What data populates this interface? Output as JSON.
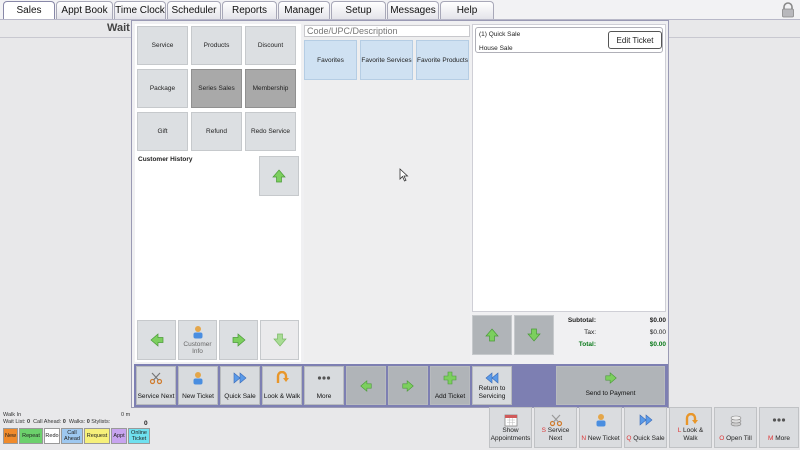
{
  "tabs": [
    {
      "label": "Sales",
      "active": true
    },
    {
      "label": "Appt Book"
    },
    {
      "label": "Time Clock"
    },
    {
      "label": "Scheduler"
    },
    {
      "label": "Reports"
    },
    {
      "label": "Manager"
    },
    {
      "label": "Setup"
    },
    {
      "label": "Messages"
    },
    {
      "label": "Help"
    }
  ],
  "background": {
    "wait_label": "Wait"
  },
  "categories": {
    "service": "Service",
    "products": "Products",
    "discount": "Discount",
    "package": "Package",
    "series_sales": "Series Sales",
    "membership": "Membership",
    "gift": "Gift",
    "refund": "Refund",
    "redo_service": "Redo Service"
  },
  "customer_history": {
    "label": "Customer History",
    "customer_info": "Customer Info"
  },
  "search": {
    "placeholder": "Code/UPC/Description"
  },
  "favorites": {
    "favorites": "Favorites",
    "services": "Favorite Services",
    "products": "Favorite Products"
  },
  "ticket": {
    "title": "(1) Quick Sale",
    "customer": "House Sale",
    "edit_label": "Edit Ticket"
  },
  "totals": {
    "subtotal_label": "Subtotal:",
    "subtotal": "$0.00",
    "tax_label": "Tax:",
    "tax": "$0.00",
    "total_label": "Total:",
    "total": "$0.00"
  },
  "actions": {
    "service_next": "Service Next",
    "new_ticket": "New Ticket",
    "quick_sale": "Quick Sale",
    "look_walk": "Look & Walk",
    "more": "More",
    "add_ticket": "Add Ticket",
    "return_servicing": "Return to Servicing",
    "send_payment": "Send to Payment"
  },
  "footer": {
    "walk_in": "Walk In",
    "wait_list_label": "Wait List:",
    "wait_list": "0",
    "call_ahead_label": "Call Ahead:",
    "call_ahead": "0",
    "walks_label": "Walks:",
    "walks": "0",
    "stylists_label": "Stylists:",
    "minutes": "0 m",
    "count": "0",
    "status": {
      "new": "New",
      "repeat": "Repeat",
      "redo": "Redo",
      "call_ahead": "Call Ahead",
      "request": "Request",
      "appt": "Appt",
      "online_ticket": "Online Ticket"
    },
    "buttons": {
      "show_appointments": "Show Appointments",
      "service_next_key": "S",
      "service_next": "Service Next",
      "new_ticket_key": "N",
      "new_ticket": "New Ticket",
      "quick_sale_key": "Q",
      "quick_sale": "Quick Sale",
      "look_walk_key": "L",
      "look_walk": "Look & Walk",
      "open_till_key": "O",
      "open_till": "Open Till",
      "more_key": "M",
      "more": "More"
    }
  },
  "colors": {
    "accent": "#7d7fb2",
    "arrow_green": "#5cc24a",
    "total_green": "#0a7a1a",
    "status_new": "#f08a2a",
    "status_repeat": "#6cd06c",
    "status_call_ahead": "#9ec8f0",
    "status_request": "#f6f07a",
    "status_appt": "#c7a4ef",
    "status_online": "#6fe0ef"
  }
}
